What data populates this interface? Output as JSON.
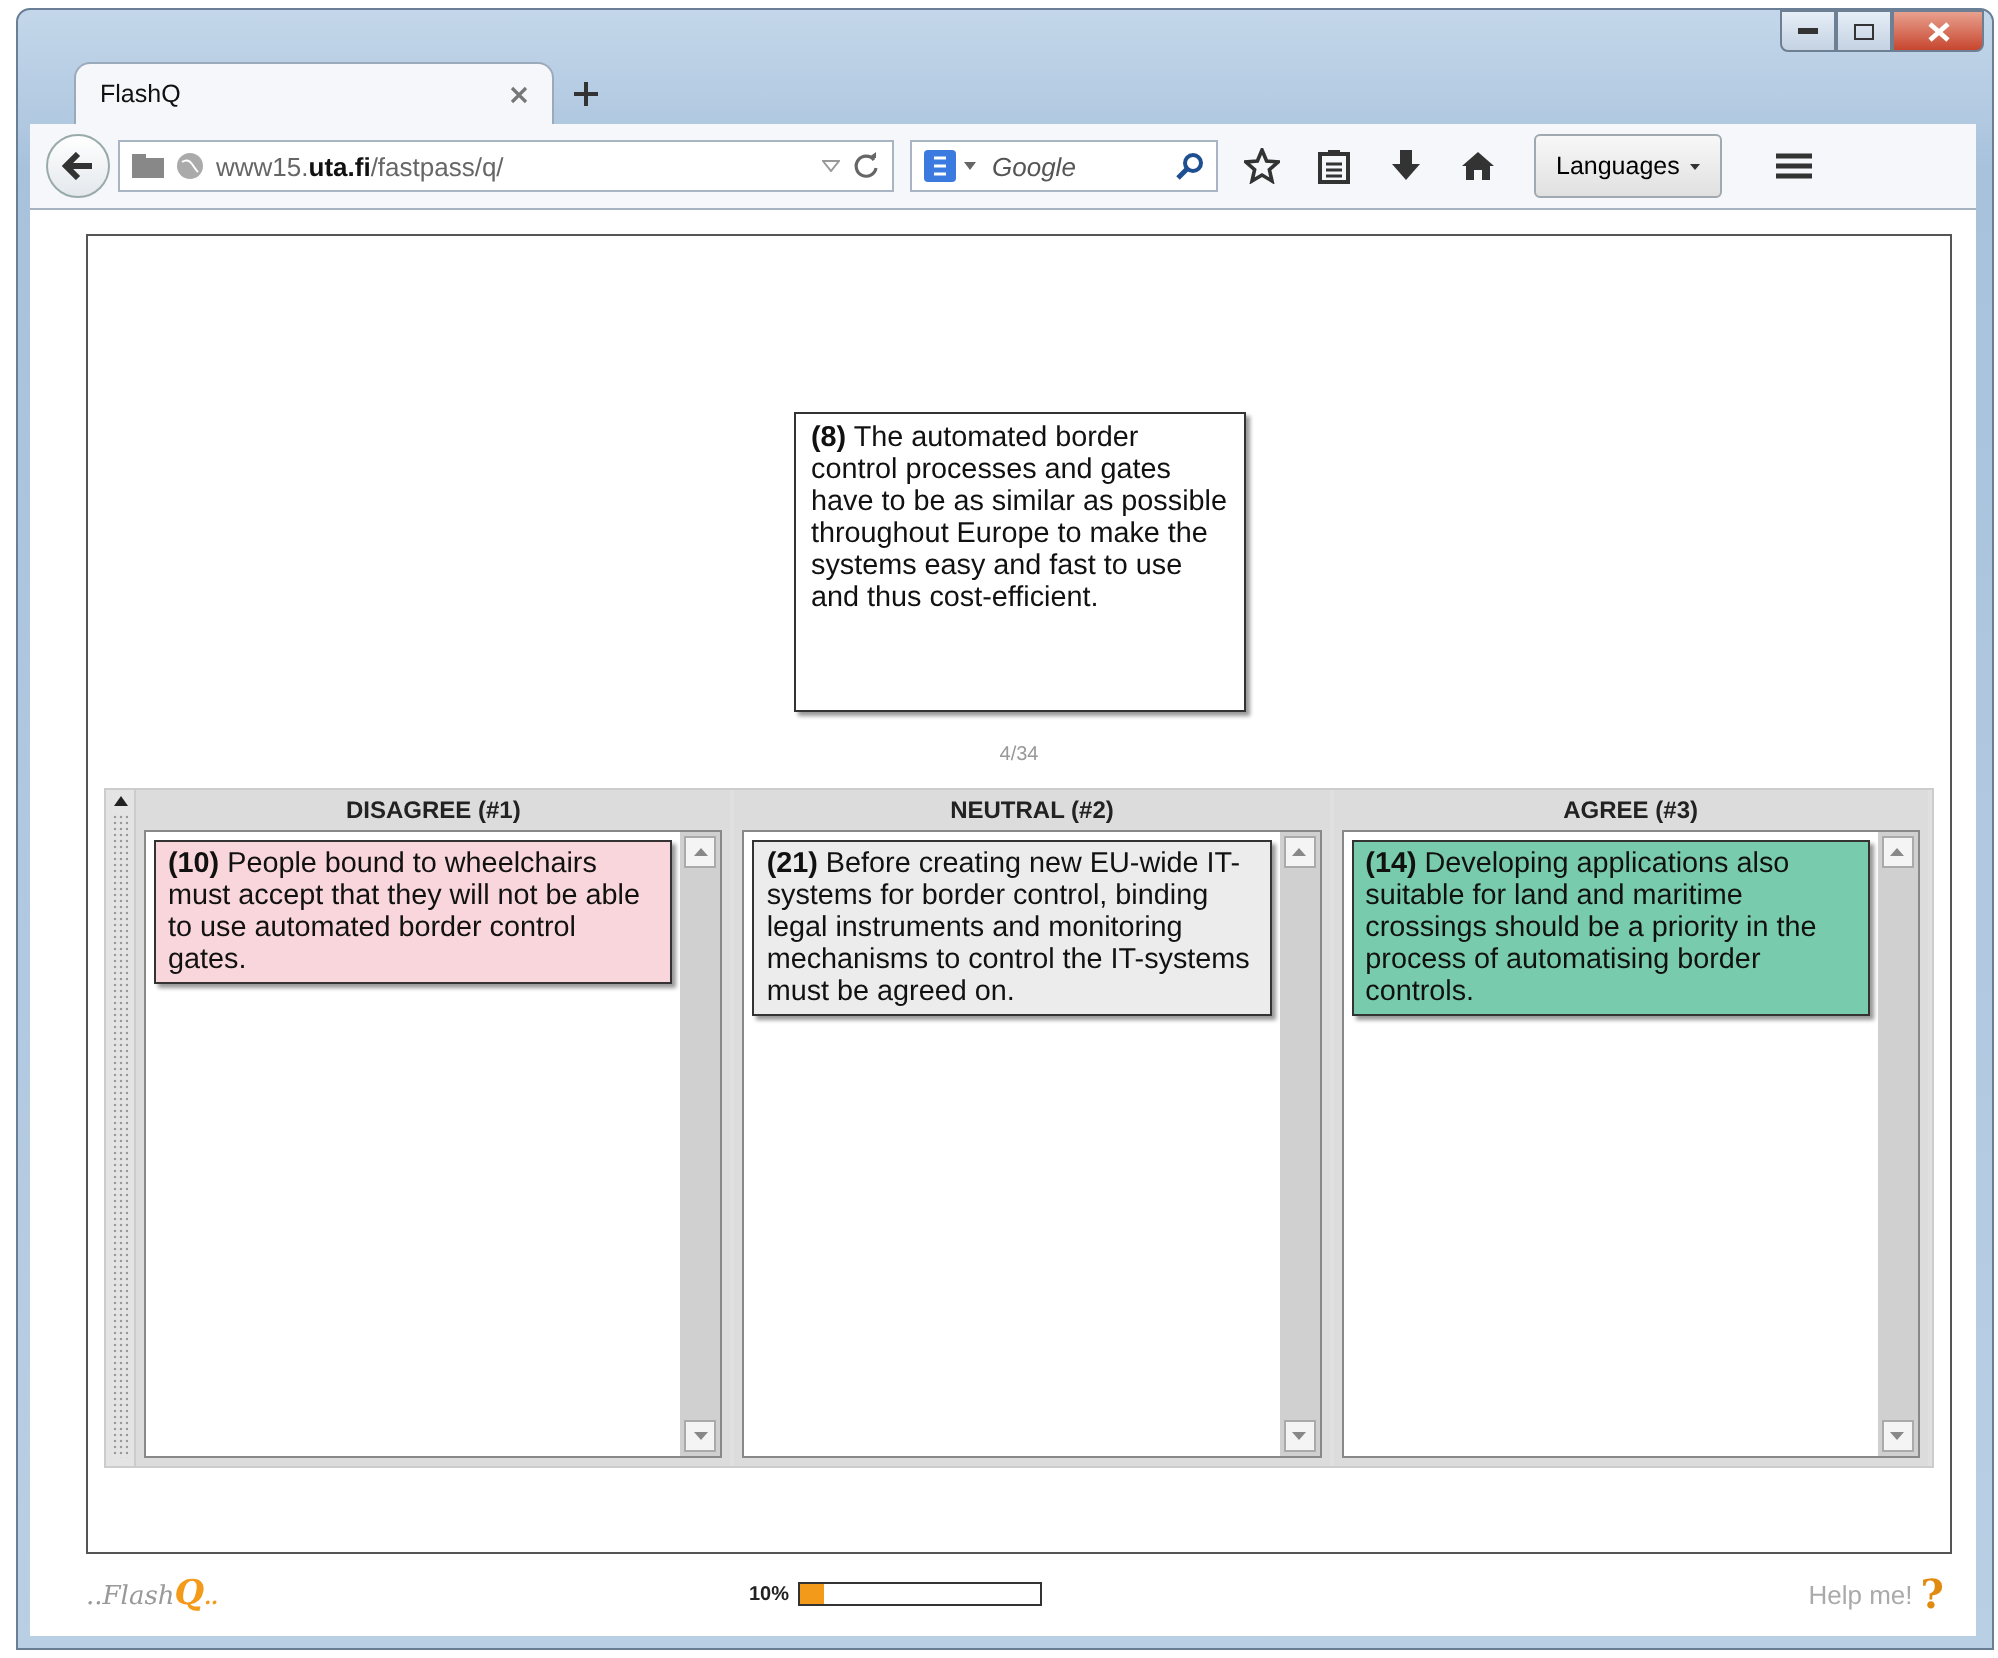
{
  "browser": {
    "tab": {
      "title": "FlashQ",
      "selected": true
    },
    "url": "www15.**uta.fi**/fastpass/q/",
    "search": {
      "placeholder": "Google"
    },
    "languages_button": "Languages"
  },
  "current_statement": {
    "text": "**(8)** The automated border control processes and gates have to be as similar as possible throughout Europe to make the systems easy and fast to use and thus cost-efficient.",
    "counter": "4/34"
  },
  "columns": [
    {
      "title": "DISAGREE (#1)",
      "cards": [
        {
          "text": "**(10)** People bound to wheelchairs must accept that they will not be able to use automated border control gates.",
          "color": "#f8d6dc"
        }
      ]
    },
    {
      "title": "NEUTRAL (#2)",
      "cards": [
        {
          "text": "**(21)** Before creating new EU-wide IT-systems for border control, binding legal instruments and monitoring mechanisms to control the IT-systems must be agreed on.",
          "color": "#ececec"
        }
      ]
    },
    {
      "title": "AGREE (#3)",
      "cards": [
        {
          "text": "**(14)** Developing applications also suitable for land and maritime crossings should be a priority in the process of automatising border controls.",
          "color": "#78cbad"
        }
      ]
    }
  ],
  "footer": {
    "logo": "..Flash",
    "logo_q": "Q",
    "logo_tail": "..",
    "progress": {
      "label": "10%",
      "level": 0.1
    },
    "help": "Help me!",
    "help_icon": "?"
  }
}
